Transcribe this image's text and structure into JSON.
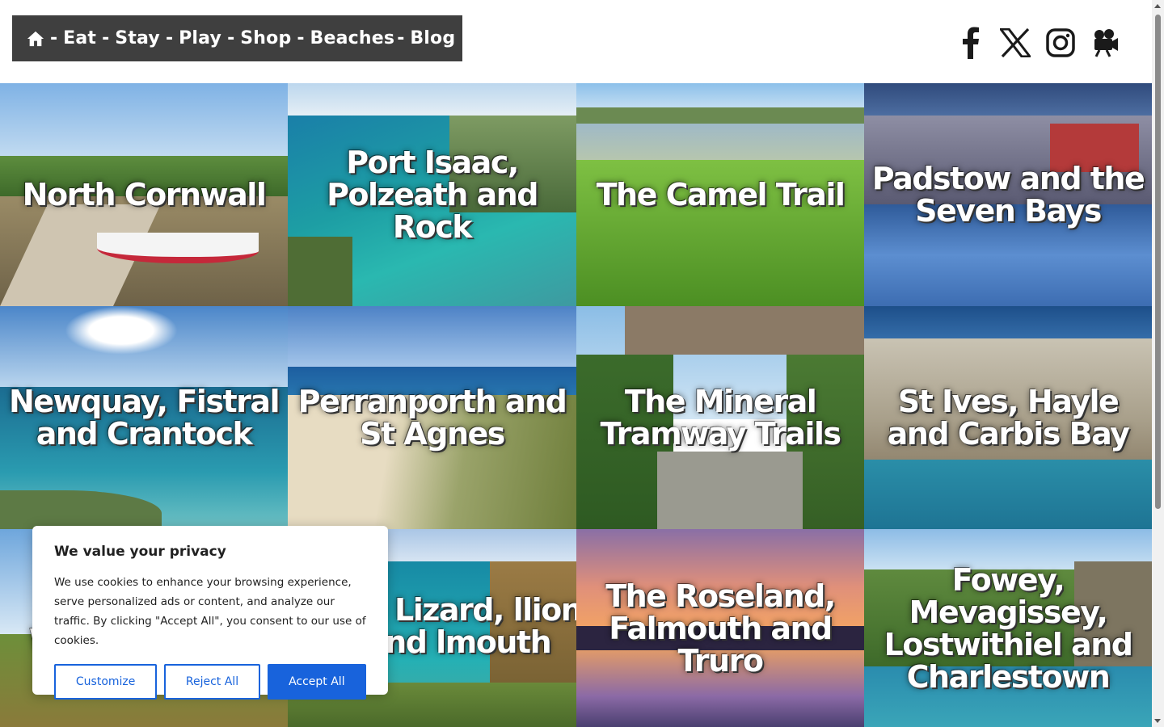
{
  "nav": {
    "home_icon": "home-icon",
    "separator": "-",
    "links": [
      "Eat",
      "Stay",
      "Play",
      "Shop",
      "Beaches",
      "Blog"
    ]
  },
  "social": [
    "facebook-icon",
    "x-icon",
    "instagram-icon",
    "video-camera-icon"
  ],
  "tiles": [
    {
      "title": "North Cornwall"
    },
    {
      "title": "Port Isaac, Polzeath and Rock"
    },
    {
      "title": "The Camel Trail"
    },
    {
      "title": "Padstow and the Seven Bays"
    },
    {
      "title": "Newquay, Fistral and Crantock"
    },
    {
      "title": "Perranporth and St Agnes"
    },
    {
      "title": "The Mineral Tramway Trails"
    },
    {
      "title": "St Ives, Hayle and Carbis Bay"
    },
    {
      "title": "W"
    },
    {
      "title": "e Lizard, llion and lmouth"
    },
    {
      "title": "The Roseland, Falmouth and Truro"
    },
    {
      "title": "Fowey, Mevagissey, Lostwithiel and Charlestown"
    }
  ],
  "cookie": {
    "title": "We value your privacy",
    "body": "We use cookies to enhance your browsing experience, serve personalized ads or content, and analyze our traffic. By clicking \"Accept All\", you consent to our use of cookies.",
    "customize": "Customize",
    "reject": "Reject All",
    "accept": "Accept All"
  },
  "colors": {
    "nav_bg": "#3f3f3f",
    "accent": "#1863dc"
  }
}
